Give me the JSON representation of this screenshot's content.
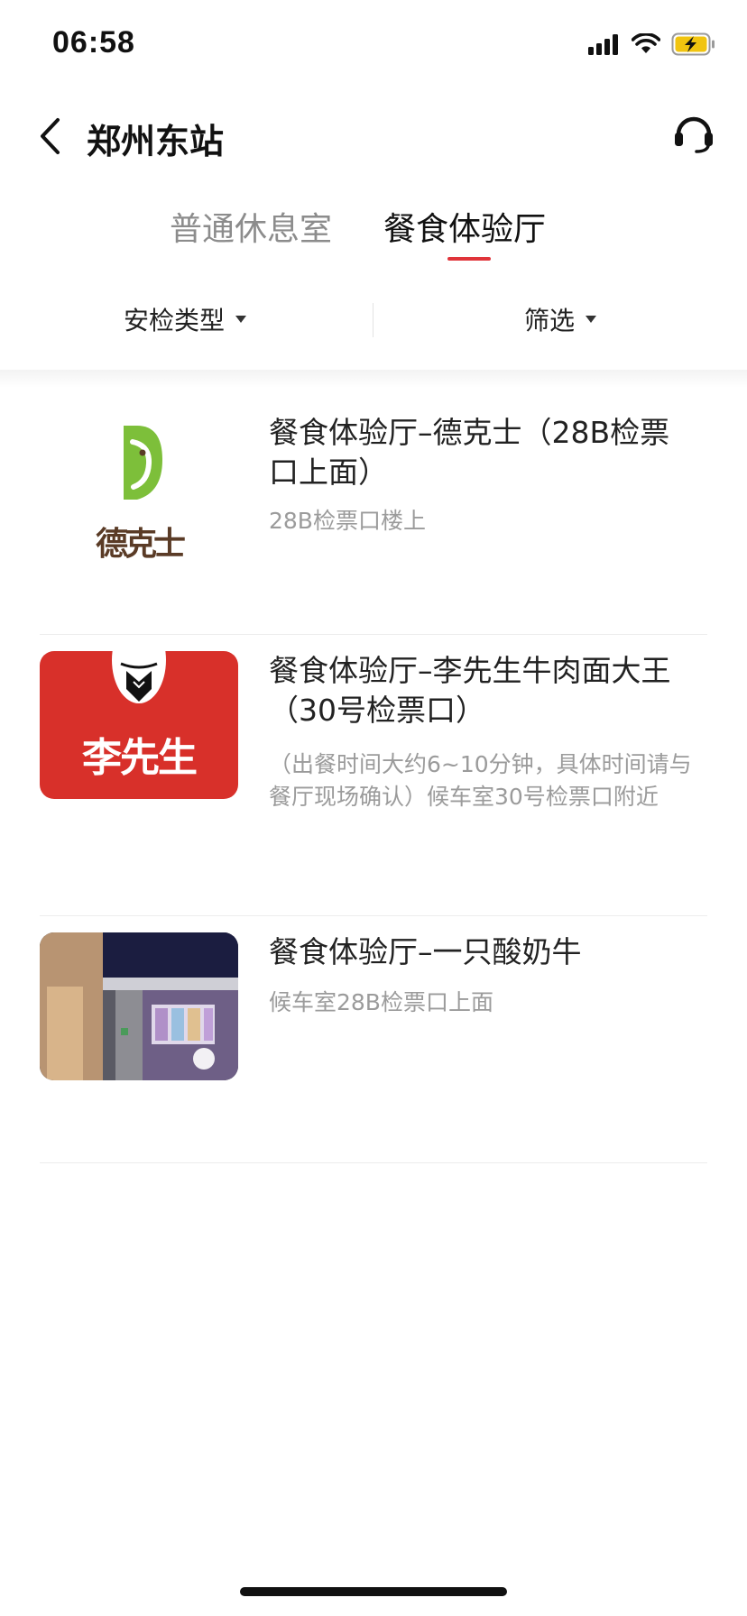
{
  "status_bar": {
    "time": "06:58"
  },
  "nav": {
    "title": "郑州东站"
  },
  "tabs": [
    {
      "label": "普通休息室",
      "active": false
    },
    {
      "label": "餐食体验厅",
      "active": true
    }
  ],
  "accent_color": "#e0343a",
  "filters": [
    {
      "label": "安检类型"
    },
    {
      "label": "筛选"
    }
  ],
  "items": [
    {
      "title": "餐食体验厅–德克士（28B检票口上面）",
      "desc": "28B检票口楼上",
      "logo_text": "德克士"
    },
    {
      "title": "餐食体验厅–李先生牛肉面大王（30号检票口）",
      "desc": "（出餐时间大约6~10分钟，具体时间请与餐厅现场确认）候车室30号检票口附近",
      "logo_text": "李先生"
    },
    {
      "title": "餐食体验厅–一只酸奶牛",
      "desc": "候车室28B检票口上面"
    }
  ]
}
